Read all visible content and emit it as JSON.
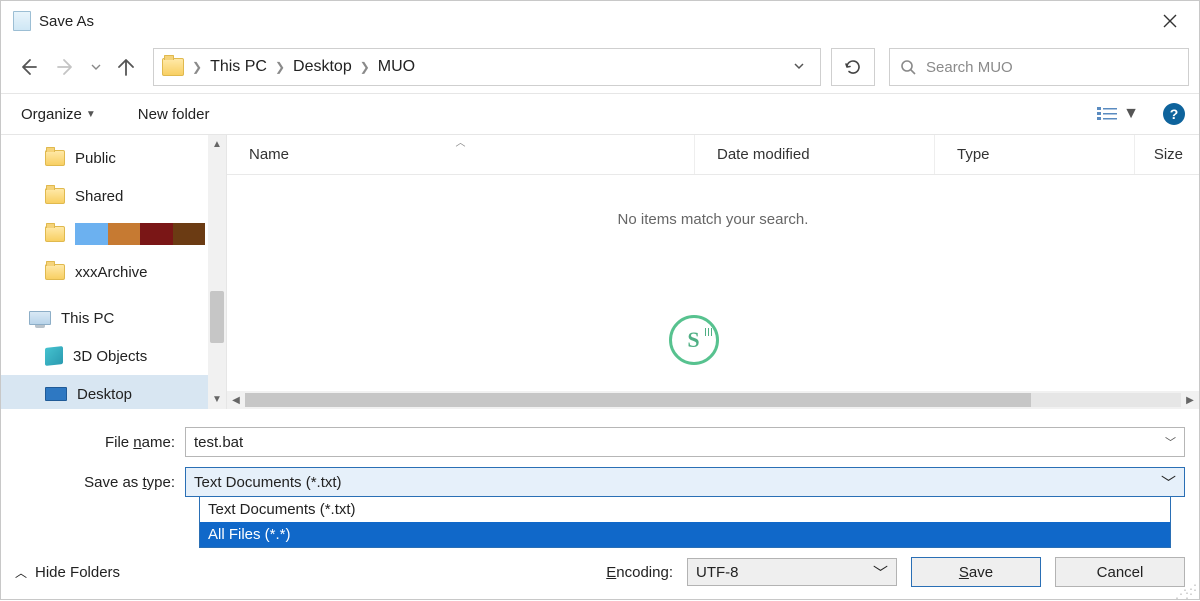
{
  "title": "Save As",
  "breadcrumbs": [
    "This PC",
    "Desktop",
    "MUO"
  ],
  "search_placeholder": "Search MUO",
  "toolbar": {
    "organize": "Organize",
    "new_folder": "New folder"
  },
  "columns": {
    "name": "Name",
    "date": "Date modified",
    "type": "Type",
    "size": "Size"
  },
  "empty_message": "No items match your search.",
  "tree": {
    "items": [
      "Public",
      "Shared",
      "",
      "xxxArchive"
    ],
    "root": "This PC",
    "children": [
      "3D Objects",
      "Desktop"
    ]
  },
  "file_name_label": "File name:",
  "file_name_value": "test.bat",
  "save_type_label": "Save as type:",
  "save_type_value": "Text Documents (*.txt)",
  "save_type_options": [
    "Text Documents (*.txt)",
    "All Files  (*.*)"
  ],
  "hide_folders": "Hide Folders",
  "encoding_label": "Encoding:",
  "encoding_value": "UTF-8",
  "buttons": {
    "save": "Save",
    "cancel": "Cancel"
  },
  "swatch_colors": [
    "#6cb1f0",
    "#c67a32",
    "#7a1616",
    "#6b3b13"
  ]
}
